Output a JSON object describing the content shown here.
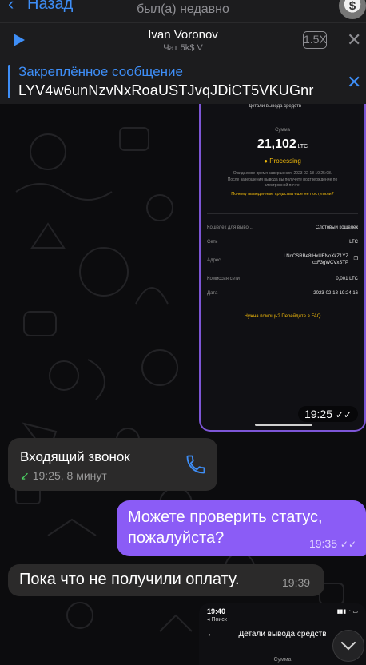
{
  "header": {
    "back_label": "Назад",
    "last_seen": "был(а) недавно"
  },
  "player": {
    "title": "Ivan Voronov",
    "subtitle": "Чат 5k$ V",
    "speed": "1.5X"
  },
  "pinned": {
    "title": "Закреплённое сообщение",
    "text": "LYV4w6unNzvNxRoaUSTJvqJDiCT5VKUGnr"
  },
  "photo_message": {
    "header_text": "Детали вывода средств",
    "sum_label": "Сумма",
    "amount": "21,102",
    "currency": "LTC",
    "status": "Processing",
    "expected_note": "Ожидаемое время завершения: 2023-02-18 19:25:08.",
    "expected_note2": "После завершения вывода вы получите подтверждение по",
    "expected_note3": "электронной почте.",
    "help_link": "Почему выведенные средства еще не поступили?",
    "rows": [
      {
        "label": "Кошелек для выво...",
        "value": "Слотовый кошелек"
      },
      {
        "label": "Сеть",
        "value": "LTC"
      },
      {
        "label": "Адрес",
        "value": "LNqCSRBe8tHxUENoXkZ1YZ",
        "value2": "cxF3gWCVxSTP"
      },
      {
        "label": "Комиссия сети",
        "value": "0,001 LTC"
      },
      {
        "label": "Дата",
        "value": "2023-02-18 19:24:16"
      }
    ],
    "faq_link": "Нужна помощь? Перейдите в FAQ",
    "time": "19:25"
  },
  "call_message": {
    "title": "Входящий звонок",
    "detail": "19:25, 8 минут"
  },
  "outgoing_message": {
    "text": "Можете проверить статус, пожалуйста?",
    "time": "19:35"
  },
  "reply_message": {
    "text": "Пока что не получили оплату.",
    "time": "19:39"
  },
  "photo_message_2": {
    "phone_time": "19:40",
    "back_label": "◂ Поиск",
    "title": "Детали вывода средств",
    "sum_label": "Сумма"
  },
  "colors": {
    "accent": "#3e8ef7",
    "outgoing_bubble": "#8b5cf6",
    "incoming_bubble": "#2b2a2a",
    "status_yellow": "#f0b90b",
    "call_green": "#4cd964"
  }
}
